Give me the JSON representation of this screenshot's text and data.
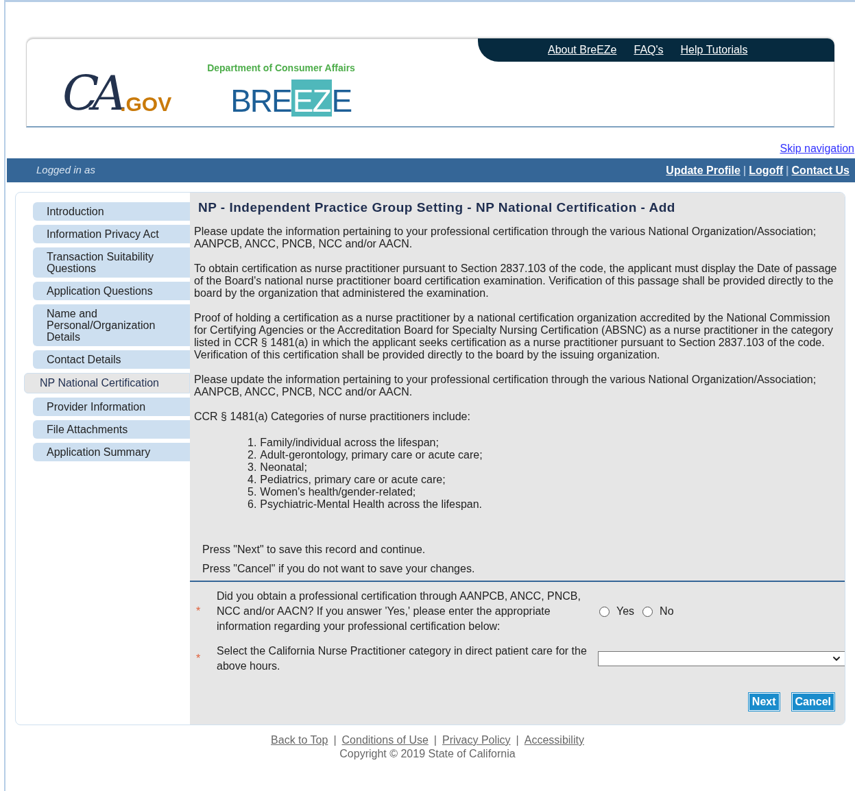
{
  "header": {
    "ca_logo": {
      "script": "CA",
      "suffix": ".GOV"
    },
    "department": "Department of Consumer Affairs",
    "breeze_logo": {
      "before": "BRE",
      "boxed": "EZ",
      "after": "E"
    },
    "top_links": [
      "About BreEZe",
      "FAQ's",
      "Help Tutorials"
    ]
  },
  "skip_link": "Skip navigation",
  "user_bar": {
    "logged_in": "Logged in as",
    "links": [
      "Update Profile",
      "Logoff",
      "Contact Us"
    ],
    "separator": "|"
  },
  "sidebar": {
    "items": [
      {
        "label": "Introduction",
        "selected": false
      },
      {
        "label": "Information Privacy Act",
        "selected": false
      },
      {
        "label": "Transaction Suitability Questions",
        "selected": false
      },
      {
        "label": "Application Questions",
        "selected": false
      },
      {
        "label": "Name and Personal/Organization Details",
        "selected": false
      },
      {
        "label": "Contact Details",
        "selected": false
      },
      {
        "label": "NP National Certification",
        "selected": true
      },
      {
        "label": "Provider Information",
        "selected": false
      },
      {
        "label": "File Attachments",
        "selected": false
      },
      {
        "label": "Application Summary",
        "selected": false
      }
    ]
  },
  "content": {
    "title": "NP - Independent Practice Group Setting - NP National Certification - Add",
    "paragraphs": [
      "Please update the information pertaining to your professional certification through the various National Organization/Association; AANPCB, ANCC, PNCB, NCC and/or AACN.",
      "To obtain certification as nurse practitioner pursuant to Section 2837.103 of the code, the applicant must display the Date of passage of the Board's national nurse practitioner board certification examination. Verification of this passage shall be provided directly to the board by the organization that administered the examination.",
      "Proof of holding a certification as a nurse practitioner by a national certification organization accredited by the National Commission for Certifying Agencies or the Accreditation Board for Specialty Nursing Certification (ABSNC) as a nurse practitioner in the category listed in CCR § 1481(a) in which the applicant seeks certification as a nurse practitioner pursuant to Section 2837.103 of the code. Verification of this certification shall be provided directly to the board by the issuing organization.",
      "Please update the information pertaining to your professional certification through the various National Organization/Association; AANPCB, ANCC, PNCB, NCC and/or AACN.",
      "CCR § 1481(a) Categories of nurse practitioners include:"
    ],
    "categories": [
      {
        "number": "1.",
        "text": "Family/individual across the lifespan;"
      },
      {
        "number": "2.",
        "text": "Adult-gerontology, primary care or acute care;"
      },
      {
        "number": "3.",
        "text": "Neonatal;"
      },
      {
        "number": "4.",
        "text": "Pediatrics, primary care or acute care;"
      },
      {
        "number": "5.",
        "text": "Women's health/gender-related;"
      },
      {
        "number": "6.",
        "text": "Psychiatric-Mental Health across the lifespan."
      }
    ],
    "instructions": [
      "Press \"Next\" to save this record and continue.",
      "Press \"Cancel\" if you do not want to save your changes."
    ],
    "questions": [
      {
        "kind": "radio",
        "required_mark": "*",
        "text": "Did you obtain a professional certification through AANPCB, ANCC, PNCB, NCC and/or AACN? If you answer 'Yes,' please enter the appropriate information regarding your professional certification below:",
        "options": [
          {
            "label": "Yes",
            "selected": false
          },
          {
            "label": "No",
            "selected": false
          }
        ]
      },
      {
        "kind": "select",
        "required_mark": "*",
        "text": "Select the California Nurse Practitioner category in direct patient care for the above hours."
      }
    ],
    "buttons": [
      "Next",
      "Cancel"
    ]
  },
  "footer": {
    "links": [
      "Back to Top",
      "Conditions of Use",
      "Privacy Policy",
      "Accessibility"
    ],
    "separator": "|",
    "copyright": "Copyright © 2019 State of California"
  }
}
